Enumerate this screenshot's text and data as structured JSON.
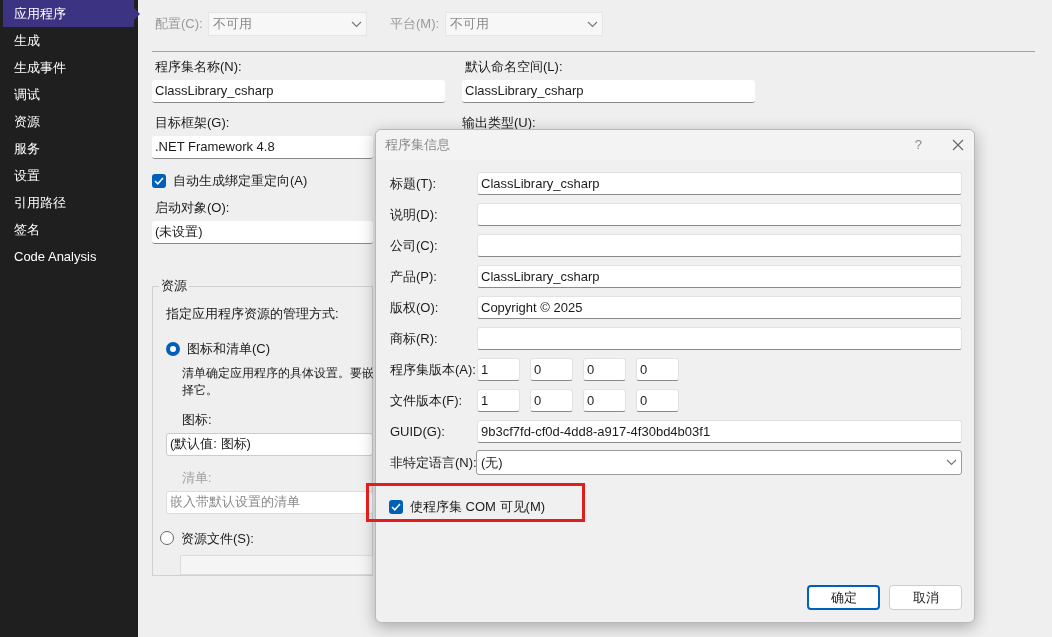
{
  "sidebar": {
    "items": [
      {
        "label": "应用程序",
        "selected": true
      },
      {
        "label": "生成",
        "selected": false
      },
      {
        "label": "生成事件",
        "selected": false
      },
      {
        "label": "调试",
        "selected": false
      },
      {
        "label": "资源",
        "selected": false
      },
      {
        "label": "服务",
        "selected": false
      },
      {
        "label": "设置",
        "selected": false
      },
      {
        "label": "引用路径",
        "selected": false
      },
      {
        "label": "签名",
        "selected": false
      },
      {
        "label": "Code Analysis",
        "selected": false
      }
    ]
  },
  "config_row": {
    "configuration": {
      "label": "配置(C):",
      "value": "不可用",
      "disabled": true
    },
    "platform": {
      "label": "平台(M):",
      "value": "不可用",
      "disabled": true
    }
  },
  "assembly_name": {
    "label": "程序集名称(N):",
    "value": "ClassLibrary_csharp"
  },
  "default_namespace": {
    "label": "默认命名空间(L):",
    "value": "ClassLibrary_csharp"
  },
  "target_framework": {
    "label": "目标框架(G):",
    "value": ".NET Framework 4.8"
  },
  "output_type": {
    "label": "输出类型(U):"
  },
  "auto_binding_redirects": {
    "label": "自动生成绑定重定向(A)",
    "checked": true
  },
  "startup_object": {
    "label": "启动对象(O):",
    "value": "(未设置)"
  },
  "resources": {
    "title": "资源",
    "instruction": "指定应用程序资源的管理方式:",
    "options": [
      {
        "label": "图标和清单(C)",
        "selected": true
      },
      {
        "label": "资源文件(S):",
        "selected": false
      }
    ],
    "description_lines": [
      "清单确定应用程序的具体设置。要嵌",
      "择它。"
    ],
    "icon": {
      "label": "图标:",
      "value": "(默认值: 图标)",
      "disabled": false
    },
    "manifest": {
      "label": "清单:",
      "value": "嵌入带默认设置的清单",
      "disabled": true
    },
    "resource_file": {
      "disabled": true
    }
  },
  "dialog": {
    "title": "程序集信息",
    "help": "?",
    "fields": [
      {
        "kind": "text",
        "label": "标题(T):",
        "value": "ClassLibrary_csharp"
      },
      {
        "kind": "text",
        "label": "说明(D):"
      },
      {
        "kind": "text",
        "label": "公司(C):"
      },
      {
        "kind": "text",
        "label": "产品(P):",
        "value": "ClassLibrary_csharp"
      },
      {
        "kind": "text",
        "label": "版权(O):",
        "value": "Copyright ©  2025"
      },
      {
        "kind": "text",
        "label": "商标(R):"
      },
      {
        "kind": "version",
        "label": "程序集版本(A):",
        "parts": [
          "1",
          "0",
          "0",
          "0"
        ]
      },
      {
        "kind": "version",
        "label": "文件版本(F):",
        "parts": [
          "1",
          "0",
          "0",
          "0"
        ]
      },
      {
        "kind": "text",
        "label": "GUID(G):",
        "value": "9b3cf7fd-cf0d-4dd8-a917-4f30bd4b03f1"
      },
      {
        "kind": "dropdown",
        "label": "非特定语言(N):",
        "value": "(无)"
      }
    ],
    "com_visible": {
      "label": "使程序集 COM 可见(M)",
      "checked": true,
      "highlighted": true
    },
    "buttons": [
      {
        "label": "确定",
        "default": true
      },
      {
        "label": "取消",
        "default": false
      }
    ]
  }
}
